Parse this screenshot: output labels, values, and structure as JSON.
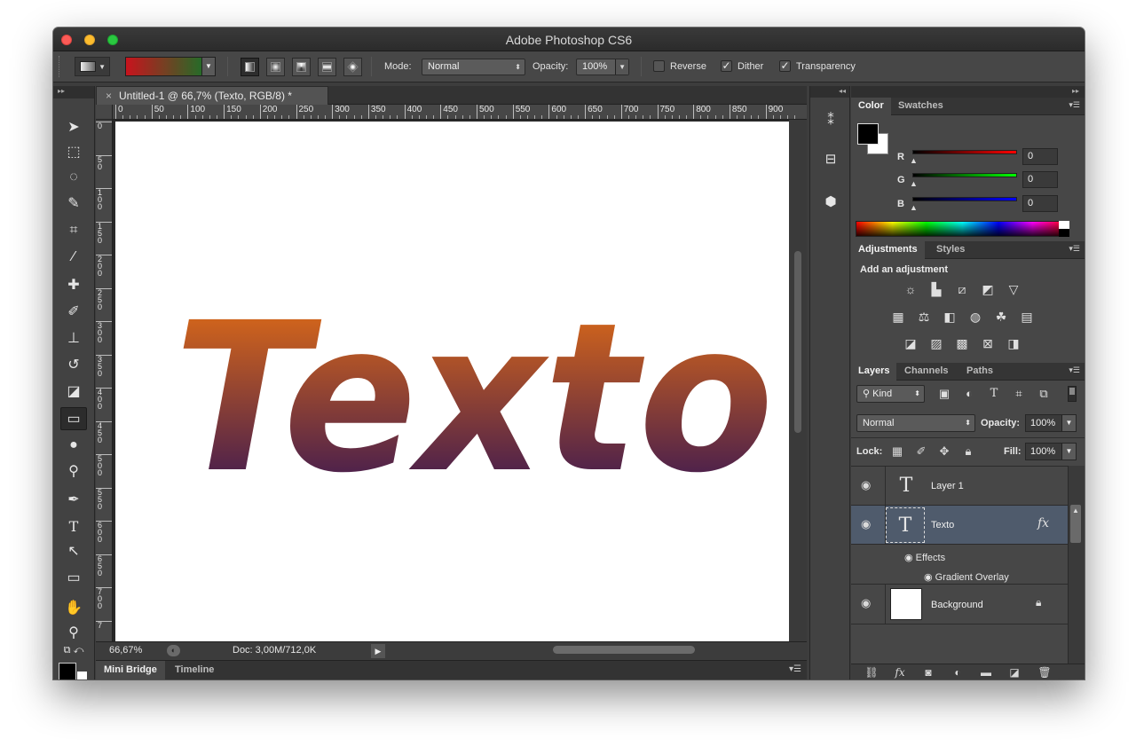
{
  "window": {
    "title": "Adobe Photoshop CS6"
  },
  "options_bar": {
    "mode_label": "Mode:",
    "mode_value": "Normal",
    "opacity_label": "Opacity:",
    "opacity_value": "100%",
    "reverse_label": "Reverse",
    "reverse_checked": false,
    "dither_label": "Dither",
    "dither_checked": true,
    "transparency_label": "Transparency",
    "transparency_checked": true,
    "gradient_colors": [
      "#c8131d",
      "#0a7a2a"
    ]
  },
  "document": {
    "tab_title": "Untitled-1 @ 66,7% (Texto, RGB/8) *",
    "close_glyph": "×",
    "canvas_text": "Texto",
    "text_gradient": [
      "#f07410",
      "#2a0f58"
    ]
  },
  "rulers": {
    "h_ticks": [
      "0",
      "50",
      "100",
      "150",
      "200",
      "250",
      "300",
      "350",
      "400",
      "450",
      "500",
      "550",
      "600",
      "650",
      "700",
      "750",
      "800",
      "850",
      "900"
    ],
    "v_ticks": [
      "0",
      "5\n0",
      "1\n0\n0",
      "1\n5\n0",
      "2\n0\n0",
      "2\n5\n0",
      "3\n0\n0",
      "3\n5\n0",
      "4\n0\n0",
      "4\n5\n0",
      "5\n0\n0",
      "5\n5\n0",
      "6\n0\n0",
      "6\n5\n0",
      "7\n0\n0",
      "7"
    ]
  },
  "status_bar": {
    "zoom": "66,67%",
    "doc_info": "Doc: 3,00M/712,0K"
  },
  "bottom_tabs": {
    "mini_bridge": "Mini Bridge",
    "timeline": "Timeline"
  },
  "color_panel": {
    "tab_color": "Color",
    "tab_swatches": "Swatches",
    "r_label": "R",
    "g_label": "G",
    "b_label": "B",
    "r_value": "0",
    "g_value": "0",
    "b_value": "0",
    "foreground": "#000000",
    "background": "#ffffff"
  },
  "adjustments_panel": {
    "tab_adjustments": "Adjustments",
    "tab_styles": "Styles",
    "add_label": "Add an adjustment"
  },
  "layers_panel": {
    "tab_layers": "Layers",
    "tab_channels": "Channels",
    "tab_paths": "Paths",
    "filter_kind": "Kind",
    "blend_mode": "Normal",
    "opacity_label": "Opacity:",
    "opacity_value": "100%",
    "lock_label": "Lock:",
    "fill_label": "Fill:",
    "fill_value": "100%",
    "layers": [
      {
        "name": "Layer 1",
        "type": "text"
      },
      {
        "name": "Texto",
        "type": "text",
        "selected": true,
        "has_fx": true
      },
      {
        "name": "Background",
        "type": "pixel",
        "locked": true
      }
    ],
    "effects_label": "Effects",
    "effect_item": "Gradient Overlay",
    "fx_glyph": "fx"
  }
}
